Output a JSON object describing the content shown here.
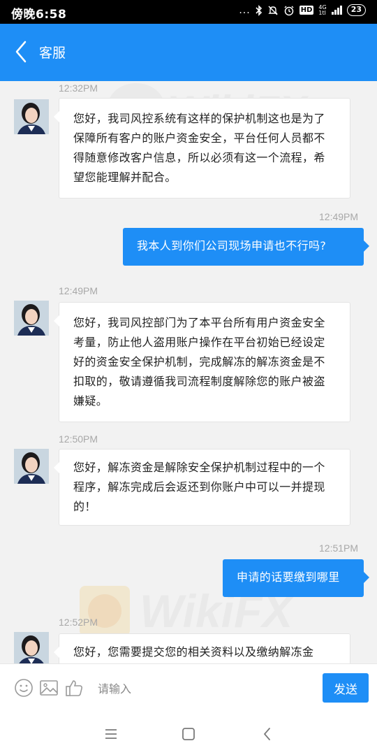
{
  "status_bar": {
    "time": "傍晚6:58",
    "dots": "...",
    "hd": "HD",
    "net_top": "4G",
    "net_bottom": "1tl",
    "battery": "23"
  },
  "header": {
    "title": "客服"
  },
  "chat": {
    "messages": [
      {
        "side": "in",
        "time": "12:32PM",
        "text": "您好，我司风控系统有这样的保护机制这也是为了保障所有客户的账户资金安全，平台任何人员都不得随意修改客户信息，所以必须有这一个流程，希望您能理解并配合。"
      },
      {
        "side": "out",
        "time": "12:49PM",
        "text": "我本人到你们公司现场申请也不行吗?"
      },
      {
        "side": "in",
        "time": "12:49PM",
        "text": "您好，我司风控部门为了本平台所有用户资金安全考量，防止他人盗用账户操作在平台初始已经设定好的资金安全保护机制，完成解冻的解冻资金是不扣取的，敬请遵循我司流程制度解除您的账户被盗嫌疑。"
      },
      {
        "side": "in",
        "time": "12:50PM",
        "text": "您好，解冻资金是解除安全保护机制过程中的一个程序，解冻完成后会返还到你账户中可以一并提现的！"
      },
      {
        "side": "out",
        "time": "12:51PM",
        "text": "申请的话要缴到哪里"
      },
      {
        "side": "in",
        "time": "12:52PM",
        "text": "您好，您需要提交您的相关资料以及缴纳解冻金"
      }
    ]
  },
  "watermark": {
    "text": "WikiFX"
  },
  "input_bar": {
    "placeholder": "请输入",
    "send_label": "发送",
    "icons": [
      "smiley-icon",
      "image-icon",
      "thumbs-up-icon"
    ]
  },
  "nav_bar": {
    "icons": [
      "menu-icon",
      "home-icon",
      "back-icon"
    ]
  },
  "colors": {
    "accent": "#1e8ef6",
    "background": "#f2f2f2",
    "timestamp": "#a8a8a8"
  }
}
